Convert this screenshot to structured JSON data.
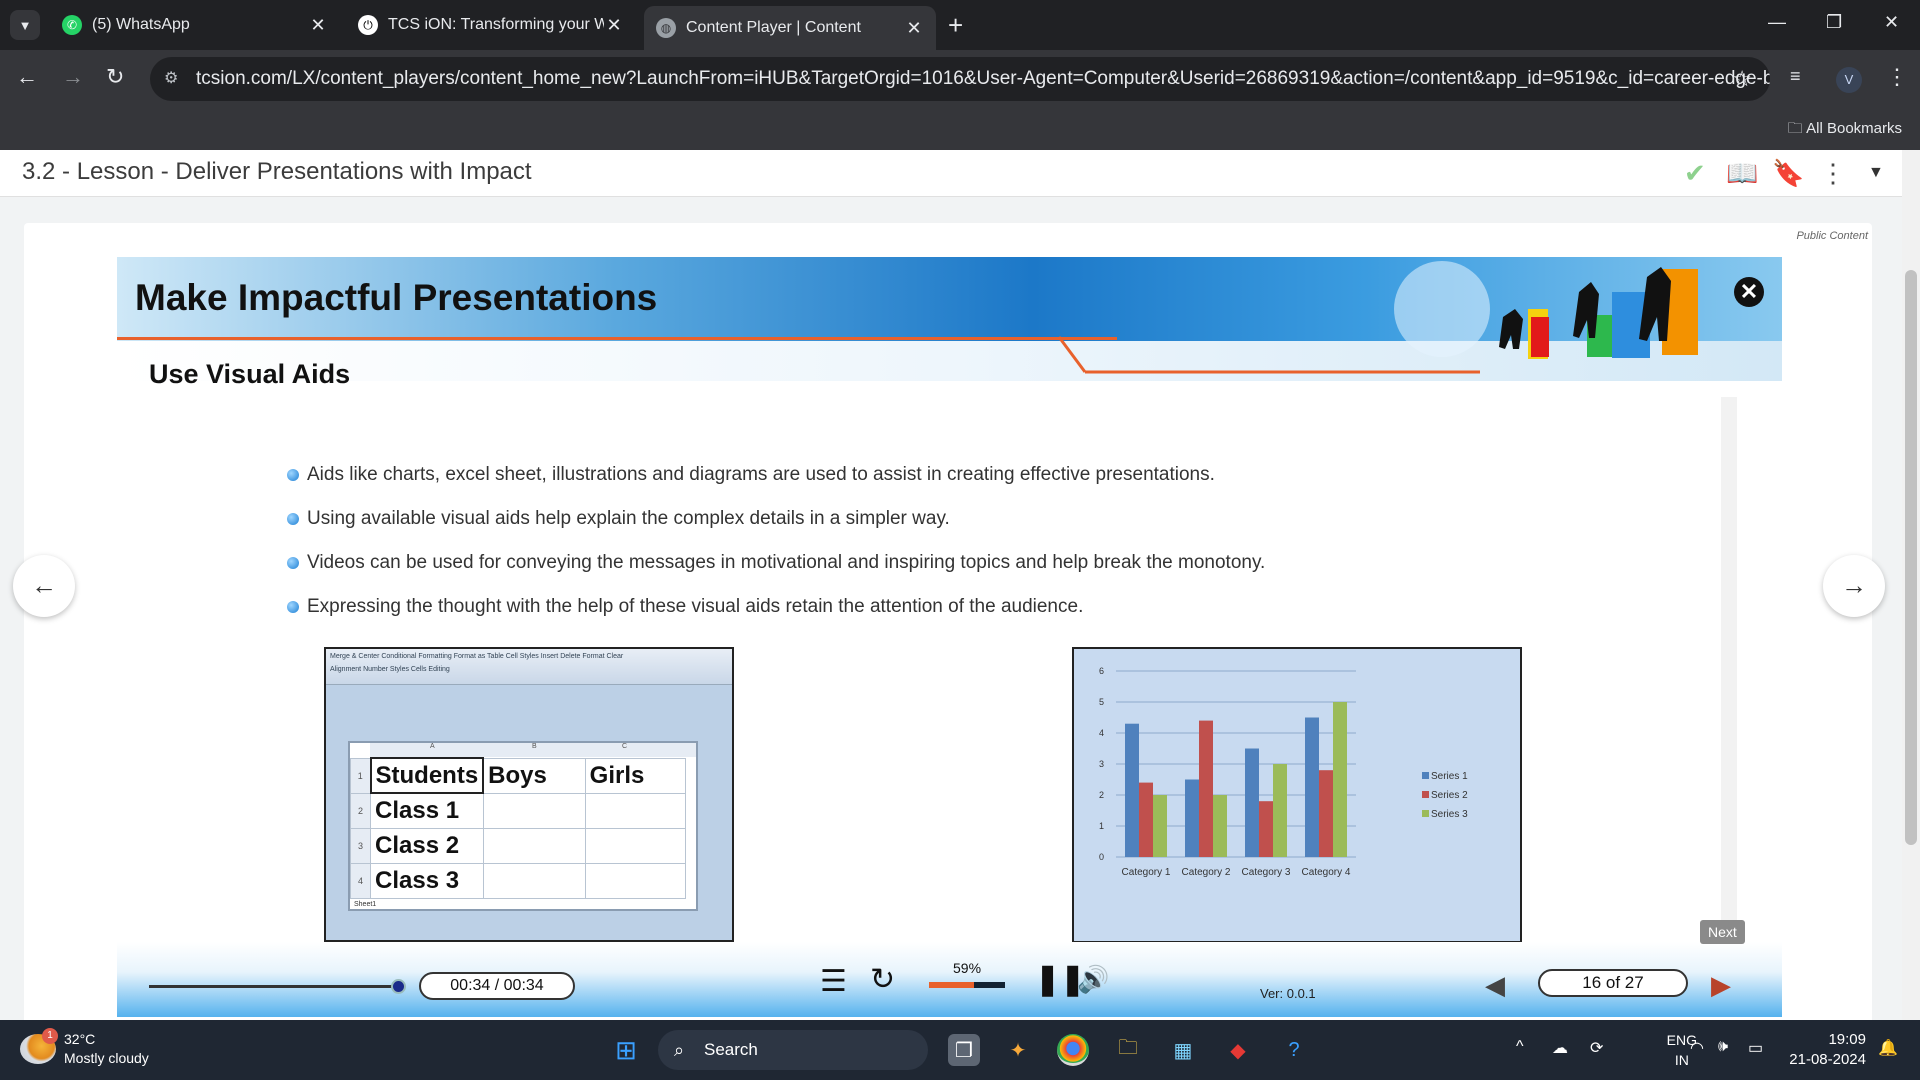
{
  "browser": {
    "tabs": [
      {
        "title": "(5) WhatsApp",
        "active": false
      },
      {
        "title": "TCS iON: Transforming your Wo",
        "active": false
      },
      {
        "title": "Content Player | Content",
        "active": true
      }
    ],
    "url": "tcsion.com/LX/content_players/content_home_new?LaunchFrom=iHUB&TargetOrgid=1016&User-Agent=Computer&Userid=26869319&action=/content&app_id=9519&c_id=career-edge-batch...",
    "profile_initial": "V",
    "bookmarks_label": "All Bookmarks"
  },
  "lesson": {
    "title": "3.2 - Lesson - Deliver Presentations with Impact",
    "public_label": "Public Content"
  },
  "slide": {
    "banner_title": "Make Impactful Presentations",
    "subtitle": "Use Visual Aids",
    "bullets": [
      "Aids like charts, excel sheet, illustrations and diagrams are used to assist in creating effective presentations.",
      "Using available visual aids help explain the complex details in a simpler way.",
      "Videos can be used for conveying the messages in motivational and inspiring topics and help break the monotony.",
      "Expressing the thought with the help of these visual aids retain the attention of the audience."
    ],
    "excel": {
      "ribbon_text": "Merge & Center   Conditional Formatting   Format as Table   Cell Styles   Insert   Delete   Format   Clear",
      "ribbon_groups": "Alignment          Number          Styles          Cells          Editing",
      "col_headers": [
        "A",
        "B",
        "C"
      ],
      "rows": [
        [
          "Students",
          "Boys",
          "Girls"
        ],
        [
          "Class 1",
          "",
          ""
        ],
        [
          "Class 2",
          "",
          ""
        ],
        [
          "Class 3",
          "",
          ""
        ]
      ],
      "row_numbers": [
        "1",
        "2",
        "3",
        "4"
      ],
      "sheet_tab": "Sheet1"
    }
  },
  "chart_data": {
    "type": "bar",
    "categories": [
      "Category 1",
      "Category 2",
      "Category 3",
      "Category 4"
    ],
    "series": [
      {
        "name": "Series 1",
        "values": [
          4.3,
          2.5,
          3.5,
          4.5
        ],
        "color": "#4f81bd"
      },
      {
        "name": "Series 2",
        "values": [
          2.4,
          4.4,
          1.8,
          2.8
        ],
        "color": "#c0504d"
      },
      {
        "name": "Series 3",
        "values": [
          2.0,
          2.0,
          3.0,
          5.0
        ],
        "color": "#9bbb59"
      }
    ],
    "ylim": [
      0,
      6
    ],
    "yticks": [
      "0",
      "1",
      "2",
      "3",
      "4",
      "5",
      "6"
    ],
    "grid": true,
    "legend": "right"
  },
  "player": {
    "time": "00:34 / 00:34",
    "progress": 1.0,
    "volume_label": "59%",
    "volume": 0.59,
    "version": "Ver: 0.0.1",
    "page": "16 of 27",
    "next_tooltip": "Next"
  },
  "taskbar": {
    "temperature": "32°C",
    "weather": "Mostly cloudy",
    "weather_badge": "1",
    "search": "Search",
    "lang_top": "ENG",
    "lang_bottom": "IN",
    "time": "19:09",
    "date": "21-08-2024"
  }
}
